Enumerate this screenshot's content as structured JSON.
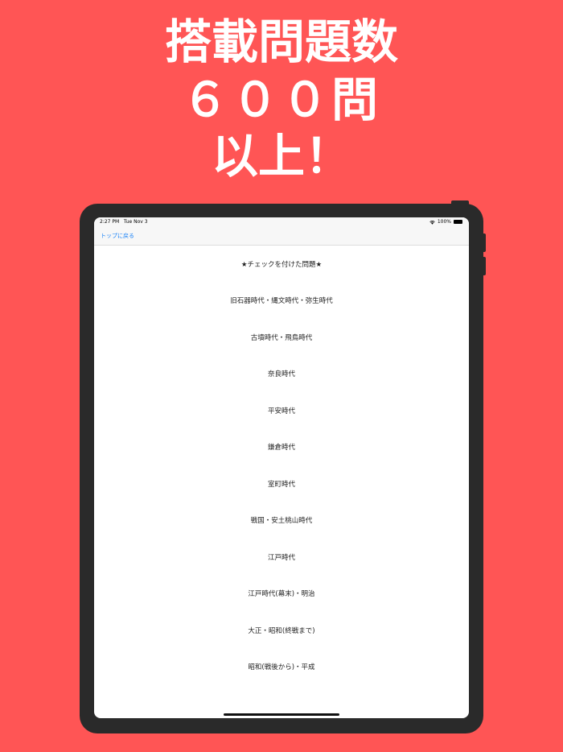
{
  "promo": {
    "line1": "搭載問題数",
    "line2": "６００問",
    "line3": "以上！"
  },
  "colors": {
    "background": "#ff5555",
    "device": "#2a2a2a",
    "link": "#1a82f7"
  },
  "status_bar": {
    "time": "2:27 PM",
    "date": "Tue Nov 3",
    "battery": "100%",
    "wifi_icon": "wifi-icon",
    "battery_icon": "battery-icon"
  },
  "nav": {
    "back_label": "トップに戻る"
  },
  "menu": {
    "items": [
      "★チェックを付けた問題★",
      "旧石器時代・縄文時代・弥生時代",
      "古墳時代・飛鳥時代",
      "奈良時代",
      "平安時代",
      "鎌倉時代",
      "室町時代",
      "戦国・安土桃山時代",
      "江戸時代",
      "江戸時代(幕末)・明治",
      "大正・昭和(終戦まで)",
      "昭和(戦後から)・平成"
    ]
  }
}
